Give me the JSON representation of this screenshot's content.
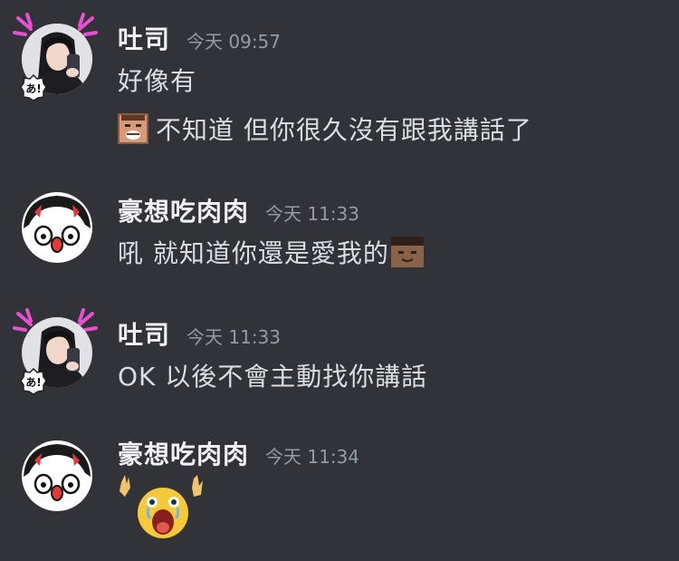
{
  "messages": [
    {
      "author": "吐司",
      "timestamp": "今天 09:57",
      "avatar_icon": "woman-selfie-avatar",
      "lines": [
        "好像有",
        "不知道 但你很久沒有跟我講話了"
      ]
    },
    {
      "author": "豪想吃肉肉",
      "timestamp": "今天 11:33",
      "avatar_icon": "cartoon-girl-avatar",
      "lines": [
        "吼 就知道你還是愛我的"
      ]
    },
    {
      "author": "吐司",
      "timestamp": "今天 11:33",
      "avatar_icon": "woman-selfie-avatar",
      "lines": [
        "OK 以後不會主動找你講話"
      ]
    },
    {
      "author": "豪想吃肉肉",
      "timestamp": "今天 11:34",
      "avatar_icon": "cartoon-girl-avatar",
      "lines": []
    }
  ],
  "badge_text": "あ!",
  "colors": {
    "background": "#313338",
    "author": "#f2f3f5",
    "text": "#dbdee1",
    "timestamp": "#949ba4",
    "decoration": "#e84fd1"
  }
}
